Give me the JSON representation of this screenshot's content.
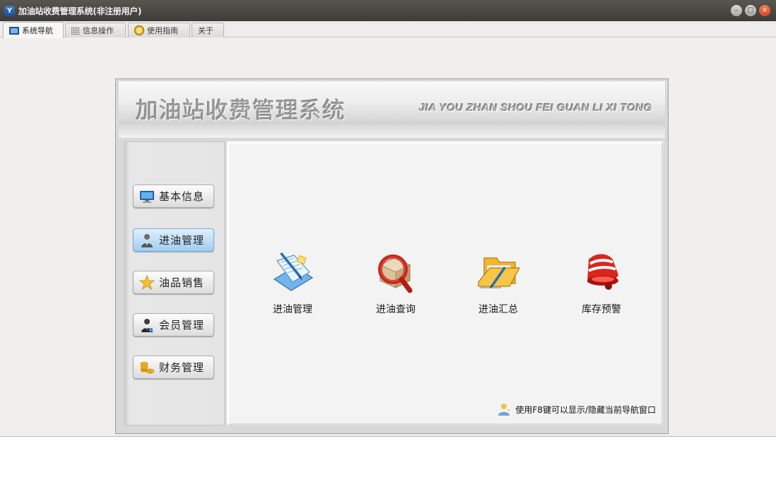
{
  "window": {
    "title": "加油站收费管理系统(非注册用户)",
    "icon_letter": "Y"
  },
  "tabs": [
    {
      "label": "系统导航",
      "icon": "monitor-icon",
      "active": true
    },
    {
      "label": "信息操作",
      "icon": "grid-icon",
      "active": false
    },
    {
      "label": "使用指南",
      "icon": "help-coin-icon",
      "active": false
    },
    {
      "label": "关于",
      "icon": "",
      "active": false
    }
  ],
  "banner": {
    "title": "加油站收费管理系统",
    "subtitle": "JIA YOU ZHAN SHOU FEI GUAN LI XI TONG"
  },
  "sidebar": {
    "items": [
      {
        "label": "基本信息",
        "icon": "monitor-icon",
        "active": false
      },
      {
        "label": "进油管理",
        "icon": "user-gray-icon",
        "active": true
      },
      {
        "label": "油品销售",
        "icon": "star-icon",
        "active": false
      },
      {
        "label": "会员管理",
        "icon": "member-icon",
        "active": false
      },
      {
        "label": "财务管理",
        "icon": "coins-icon",
        "active": false
      }
    ]
  },
  "content": {
    "tiles": [
      {
        "label": "进油管理",
        "icon": "document-pen-icon"
      },
      {
        "label": "进油查询",
        "icon": "magnifier-box-icon"
      },
      {
        "label": "进油汇总",
        "icon": "folder-pen-icon"
      },
      {
        "label": "库存预警",
        "icon": "alarm-bell-icon"
      }
    ],
    "hint": "使用F8键可以显示/隐藏当前导航窗口"
  },
  "colors": {
    "titlebar": "#46453f",
    "active_nav": "#9fcdf1",
    "close_button": "#e4562a"
  }
}
